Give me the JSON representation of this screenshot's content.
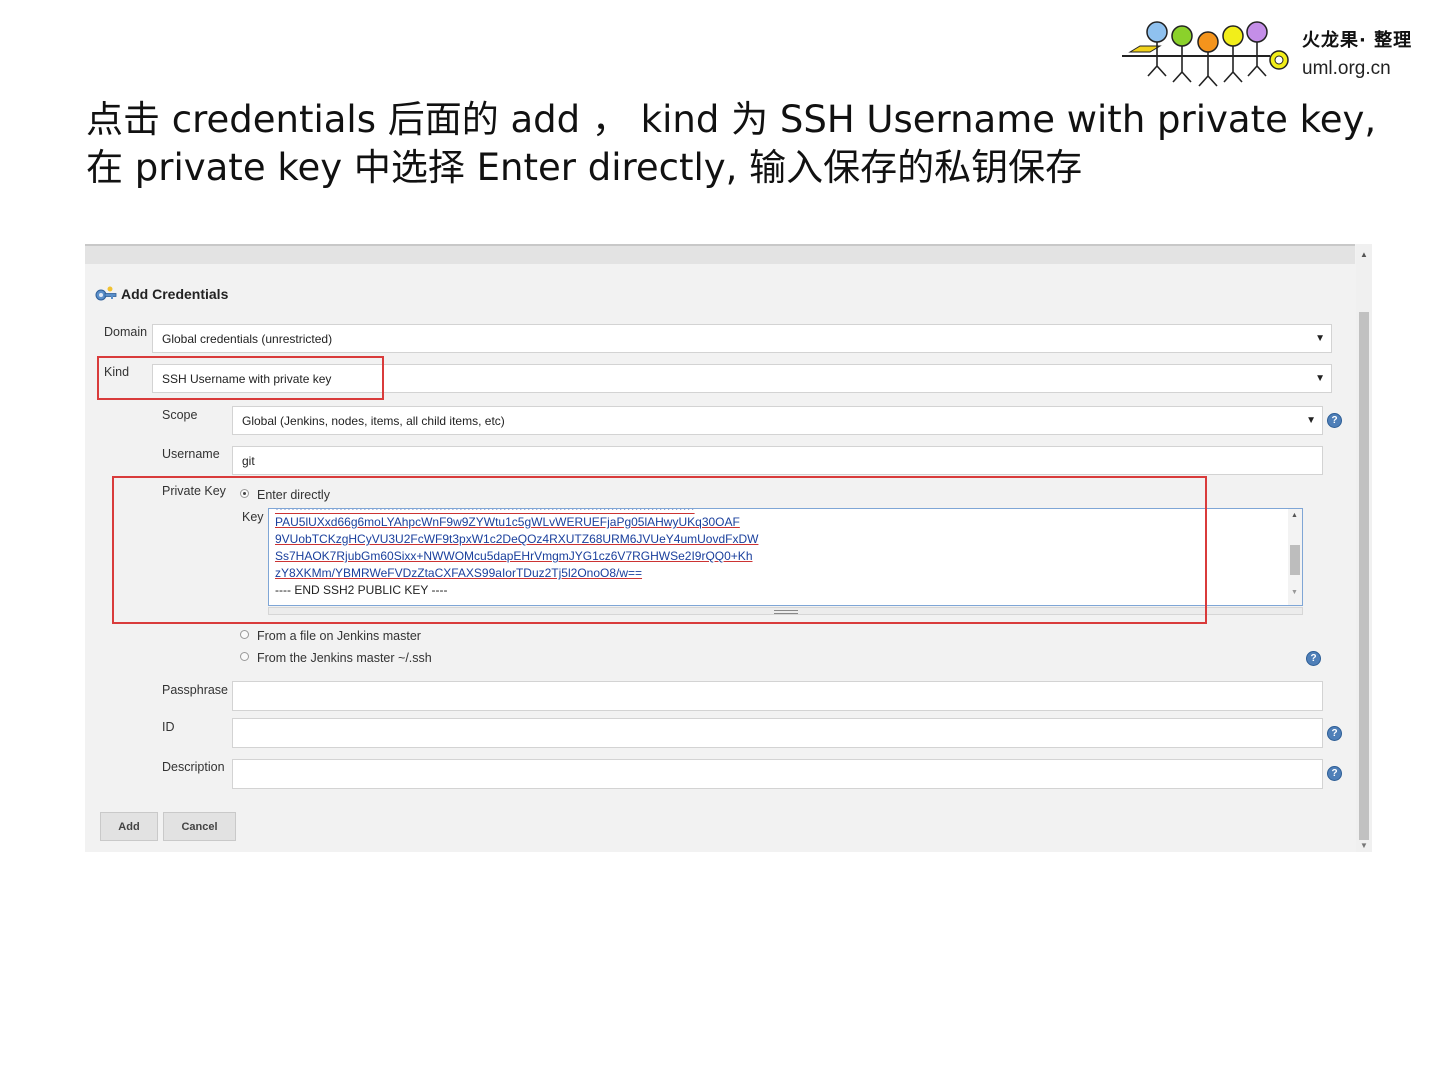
{
  "slide": {
    "logo_title": "火龙果· 整理",
    "logo_url": "uml.org.cn",
    "instruction_line1": "点击 credentials 后面的 add  ， kind 为 SSH Username with private key,",
    "instruction_line2": "在 private key  中选择 Enter directly, 输入保存的私钥保存"
  },
  "dialog": {
    "title": "Add Credentials",
    "domain": {
      "label": "Domain",
      "value": "Global credentials (unrestricted)"
    },
    "kind": {
      "label": "Kind",
      "value": "SSH Username with private key"
    },
    "scope": {
      "label": "Scope",
      "value": "Global (Jenkins, nodes, items, all child items, etc)"
    },
    "username": {
      "label": "Username",
      "value": "git"
    },
    "private_key": {
      "label": "Private Key",
      "options": [
        "Enter directly",
        "From a file on Jenkins master",
        "From the Jenkins master ~/.ssh"
      ],
      "selected": "Enter directly",
      "key_label": "Key",
      "key_lines": [
        "PAU5lUXxd66g6moLYAhpcWnF9w9ZYWtu1c5gWLvWERUEFjaPg05lAHwyUKq30OAF",
        "9VUobTCKzgHCyVU3U2FcWF9t3pxW1c2DeQOz4RXUTZ68URM6JVUeY4umUovdFxDW",
        "Ss7HAOK7RjubGm60Sixx+NWWOMcu5dapEHrVmgmJYG1cz6V7RGHWSe2I9rQQ0+Kh",
        "zY8XKMm/YBMRWeFVDzZtaCXFAXS99aIorTDuz2Tj5l2OnoO8/w==",
        "---- END SSH2 PUBLIC KEY ----"
      ]
    },
    "passphrase": {
      "label": "Passphrase",
      "value": ""
    },
    "id": {
      "label": "ID",
      "value": ""
    },
    "description": {
      "label": "Description",
      "value": ""
    },
    "buttons": {
      "add": "Add",
      "cancel": "Cancel"
    }
  },
  "colors": {
    "annotation_red": "#d93b3b",
    "help_blue": "#4f7fb8"
  }
}
